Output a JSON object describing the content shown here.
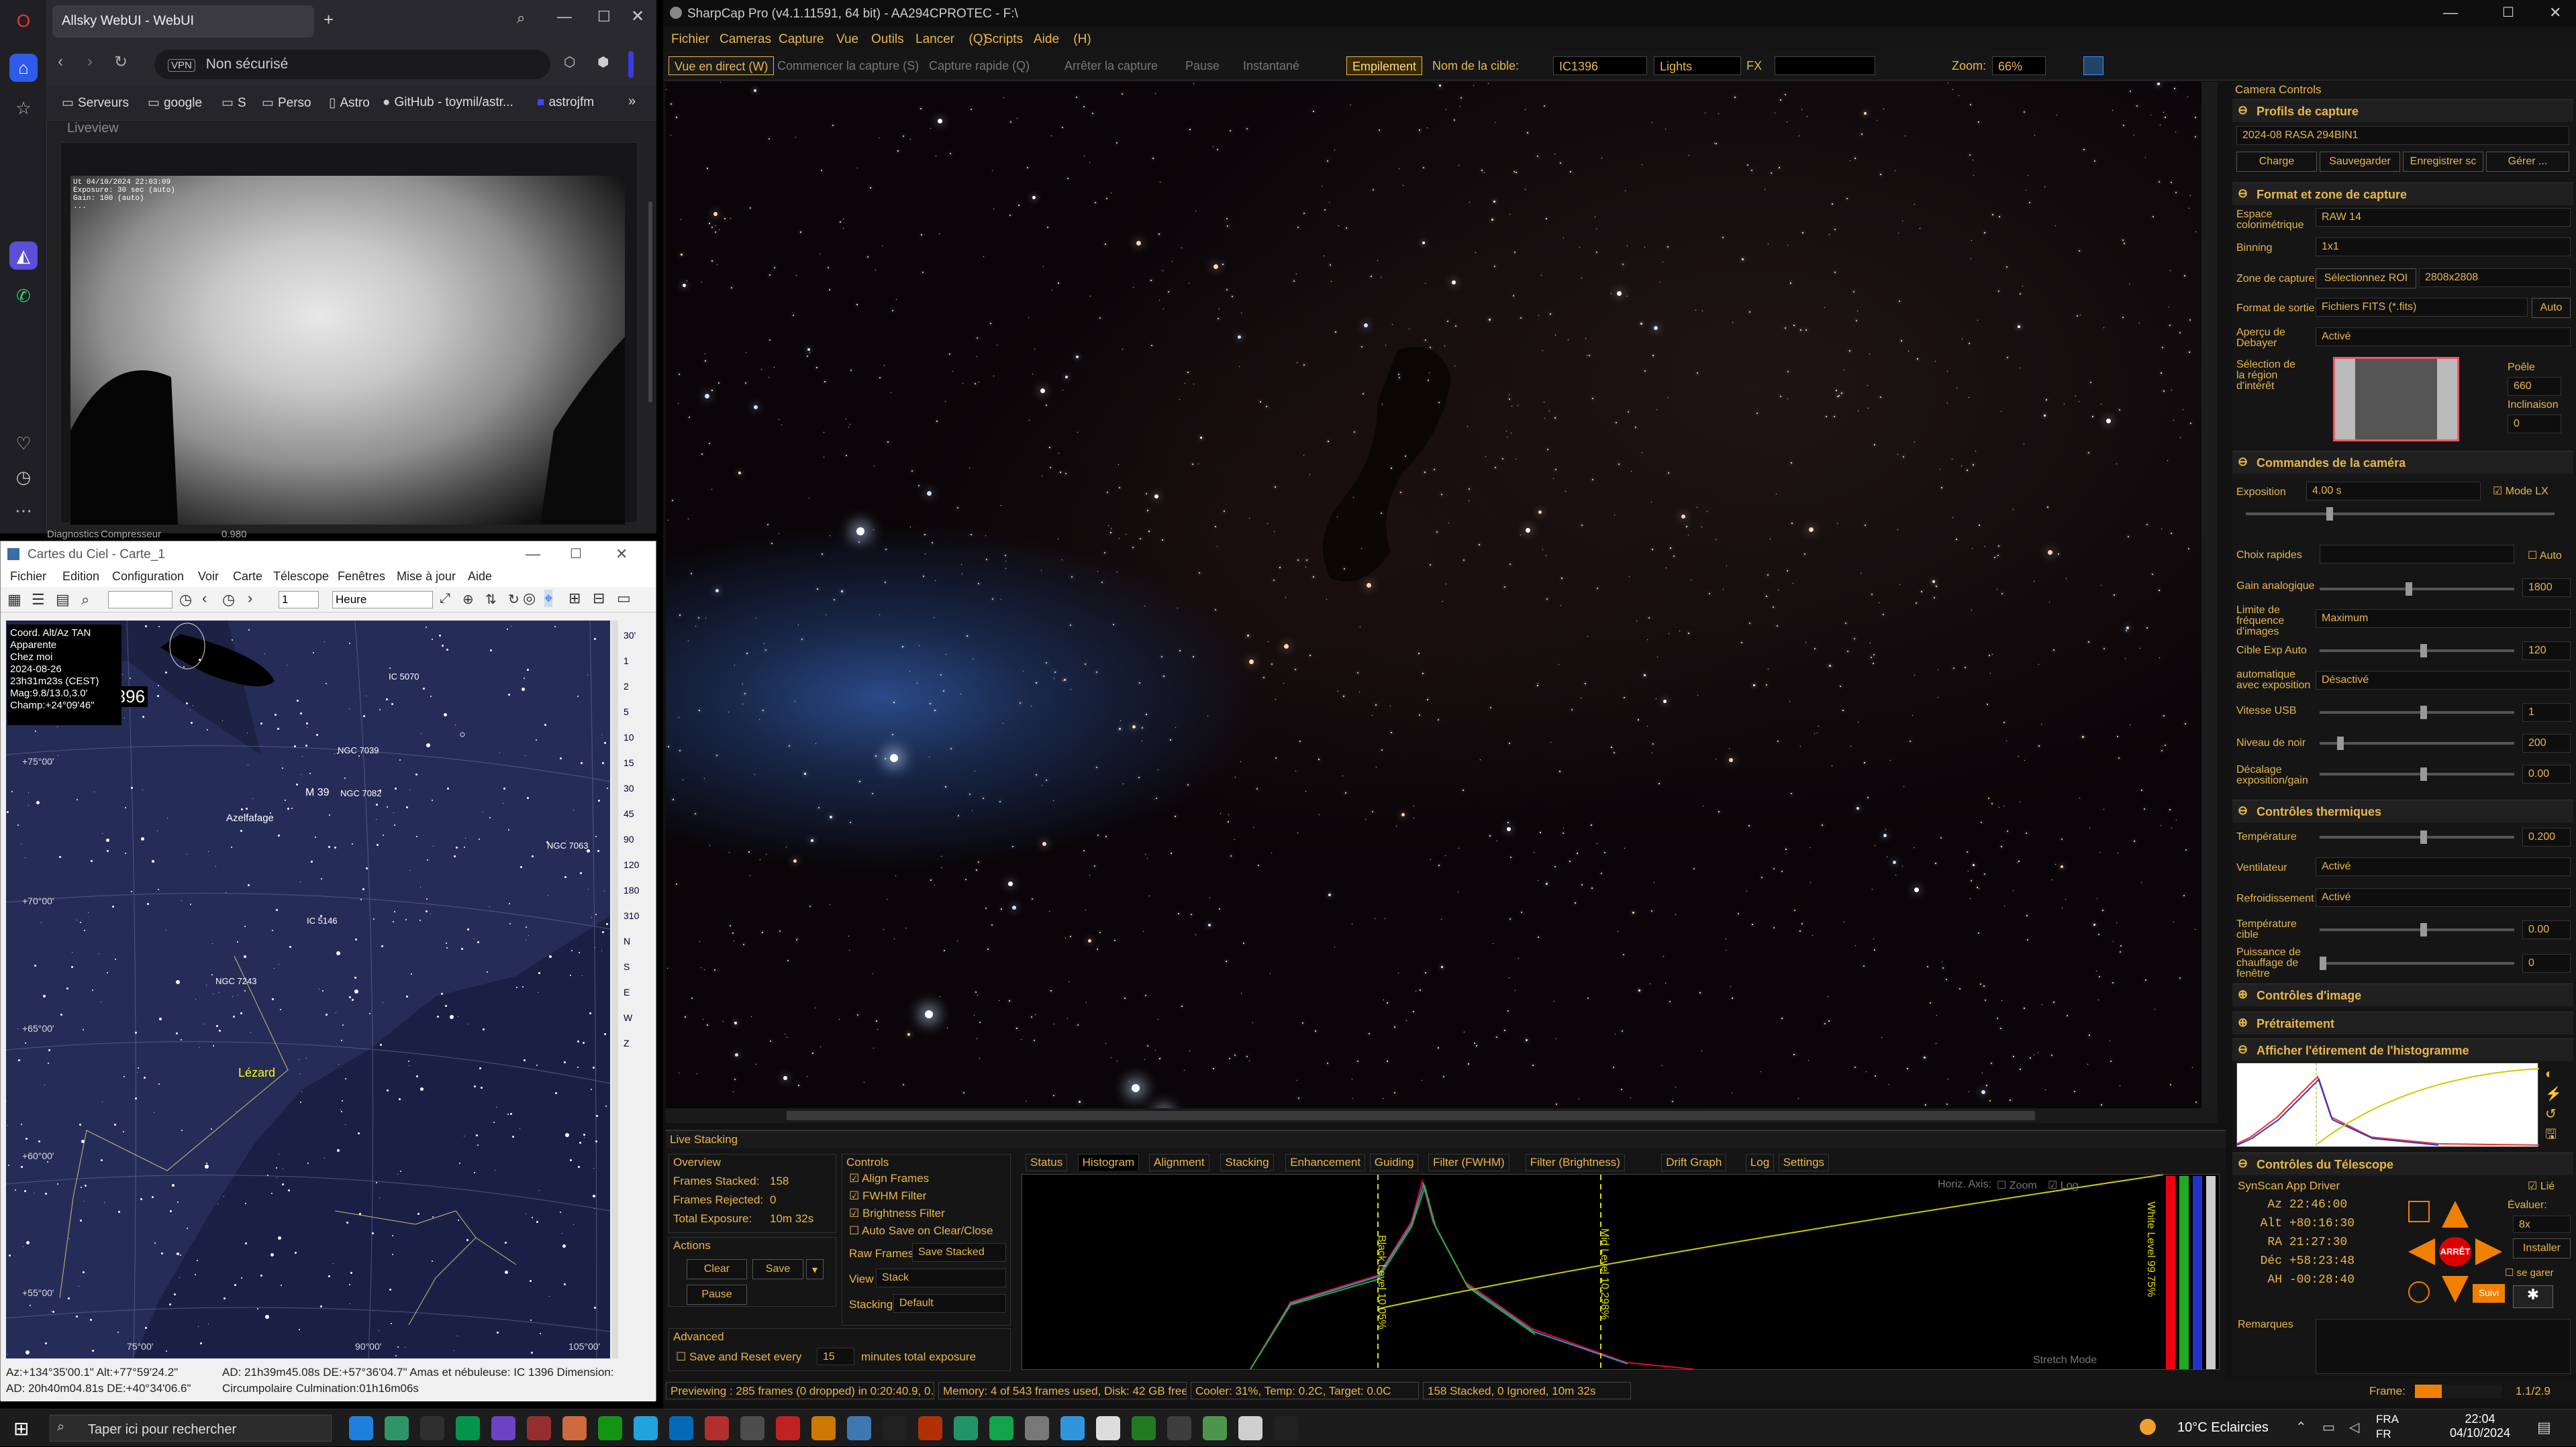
{
  "opera": {
    "tab_title": "Allsky WebUI - WebUI",
    "tab_count": "1",
    "vpn": "VPN",
    "address": "Non sécurisé",
    "bookmarks": [
      "Serveurs",
      "google",
      "S",
      "Perso",
      "Astro",
      "GitHub - toymil/astr...",
      "astrojfm"
    ],
    "liveview_label": "Liveview",
    "overlay_lines": [
      "Ut 04/10/2024 22:03:09",
      "Exposure: 30 sec (auto)",
      "Gain: 100 (auto)",
      "..."
    ],
    "below_labels": [
      "Diagnostics",
      "Compresseur",
      "0.980"
    ]
  },
  "cdc": {
    "title": "Cartes du Ciel - Carte_1",
    "menu": [
      "Fichier",
      "Edition",
      "Configuration",
      "Voir",
      "Carte",
      "Télescope",
      "Fenêtres",
      "Mise à jour",
      "Aide"
    ],
    "time_field": "1",
    "time_unit": "Heure",
    "info_lines": [
      "Coord. Alt/Az TAN",
      "Apparente",
      "Chez moi",
      "2024-08-26",
      "23h31m23s (CEST)",
      "Mag:9.8/13.0,3.0'",
      "Champ:+24°09'46\""
    ],
    "labels": {
      "ic1396": "IC 1396",
      "m39": "M 39",
      "ngc7082": "NGC 7082",
      "ngc7039": "NGC 7039",
      "ngc7063": "NGC 7063",
      "ngc7243": "NGC 7243",
      "ic5146": "IC 5146",
      "ic5070": "IC 5070",
      "azelfafage": "Azelfafage",
      "lezard": "Lézard",
      "alt75": "+75°00'",
      "alt70": "+70°00'",
      "alt65": "+65°00'",
      "alt60": "+60°00'",
      "alt55": "+55°00'",
      "az75": "75°00'",
      "az90": "90°00'",
      "az105": "105°00'"
    },
    "rtools": [
      "30'",
      "1",
      "2",
      "5",
      "10",
      "15",
      "30",
      "45",
      "90",
      "120",
      "180",
      "310",
      "N",
      "S",
      "E",
      "W",
      "Z"
    ],
    "status_line1": "Az:+134°35'00.1\" Alt:+77°59'24.2\"",
    "status_line2": "AD: 20h40m04.81s DE:+40°34'06.6\"",
    "status_right1": "AD: 21h39m45.08s DE:+57°36'04.7\"   Amas et nébuleuse: IC 1396   Dimension:",
    "status_right2": "Circumpolaire   Culmination:01h16m06s"
  },
  "sc": {
    "title": "SharpCap Pro (v4.1.11591, 64 bit) - AA294CPROTEC - F:\\",
    "menu": [
      "Fichier",
      "Cameras",
      "Capture",
      "Vue",
      "Outils",
      "Lancer (Q)",
      "Scripts",
      "Aide (H)"
    ],
    "toolbar": {
      "live": "Vue en direct (W)",
      "start": "Commencer la capture (S)",
      "quick": "Capture rapide (Q)",
      "stop": "Arrêter la capture",
      "pause": "Pause",
      "snap": "Instantané",
      "stack": "Empilement",
      "target_label": "Nom de la cible:",
      "target": "IC1396",
      "frametype": "Lights",
      "fx": "FX",
      "zoom_label": "Zoom:",
      "zoom": "66%"
    },
    "panel": {
      "header": "Camera Controls",
      "profiles_title": "Profils de capture",
      "profile": "2024-08 RASA 294BIN1",
      "profile_buttons": [
        "Charge",
        "Sauvegarder",
        "Enregistrer sc",
        "Gérer ..."
      ],
      "format_title": "Format et zone de capture",
      "color_space_label": "Espace colorimétrique",
      "color_space": "RAW 14",
      "binning_label": "Binning",
      "binning": "1x1",
      "zone_label": "Zone de capture",
      "roi_button": "Sélectionnez ROI",
      "zone": "2808x2808",
      "output_label": "Format de sortie",
      "output": "Fichiers FITS (*.fits)",
      "auto": "Auto",
      "debayer_label": "Aperçu de Debayer",
      "debayer": "Activé",
      "roi_label": "Sélection de la région d'intérêt",
      "poele_label": "Poêle",
      "poele": "660",
      "incl_label": "Inclinaison",
      "incl": "0",
      "cam_title": "Commandes de la caméra",
      "exposure_label": "Exposition",
      "exposure": "4.00 s",
      "mode_lx": "Mode LX",
      "quick_label": "Choix rapides",
      "auto2": "Auto",
      "gain_label": "Gain analogique",
      "gain": "1800",
      "fps_label": "Limite de fréquence d'images",
      "fps": "Maximum",
      "autoexp_label": "Cible Exp Auto",
      "autoexp": "120",
      "autoexp2_label": "automatique avec exposition",
      "autoexp2": "Désactivé",
      "usb_label": "Vitesse USB",
      "usb": "1",
      "black_label": "Niveau de noir",
      "black": "200",
      "offset_label": "Décalage exposition/gain",
      "offset": "0.00",
      "thermal_title": "Contrôles thermiques",
      "temp_label": "Température",
      "temp": "0.200",
      "fan_label": "Ventilateur",
      "fan": "Activé",
      "cool_label": "Refroidissement",
      "cool": "Activé",
      "target_temp_label": "Température cible",
      "target_temp": "0.00",
      "heater_label": "Puissance de chauffage de fenêtre",
      "heater": "0",
      "image_title": "Contrôles d'image",
      "preproc_title": "Prétraitement",
      "hist_title": "Afficher l'étirement de l'histogramme",
      "tel_title": "Contrôles du Télescope",
      "driver": "SynScan App Driver",
      "lie": "Lié",
      "az_label": "Az",
      "az": "22:46:00",
      "alt_label": "Alt",
      "alt": "+80:16:30",
      "ra_label": "RA",
      "ra": "21:27:30",
      "dec_label": "Déc",
      "dec": "+58:23:48",
      "ah_label": "AH",
      "ah": "-00:28:40",
      "rate_label": "Évaluer:",
      "rate": "8x",
      "install": "Installer",
      "garer": "se garer",
      "stop": "ARRÊT",
      "suivi": "Suivi",
      "remarks": "Remarques"
    },
    "ls": {
      "title": "Live Stacking",
      "overview": "Overview",
      "stacked_label": "Frames Stacked:",
      "stacked": "158",
      "rejected_label": "Frames Rejected:",
      "rejected": "0",
      "total_label": "Total Exposure:",
      "total": "10m 32s",
      "actions": "Actions",
      "clear": "Clear",
      "save": "Save",
      "pause": "Pause",
      "advanced": "Advanced",
      "save_reset": "Save and Reset every",
      "every_val": "15",
      "every_unit": "minutes total exposure",
      "controls": "Controls",
      "align": "Align Frames",
      "fwhm": "FWHM Filter",
      "bright": "Brightness Filter",
      "autosave": "Auto Save on Clear/Close",
      "raw_label": "Raw Frames",
      "raw": "Save Stacked",
      "view_label": "View",
      "view": "Stack",
      "stacking_label": "Stacking",
      "stacking": "Default",
      "tabs": [
        "Status",
        "Histogram",
        "Alignment",
        "Stacking",
        "Enhancement",
        "Guiding",
        "Filter (FWHM)",
        "Filter (Brightness)",
        "Drift Graph",
        "Log",
        "Settings"
      ],
      "horiz": "Horiz. Axis:",
      "zoom": "Zoom",
      "log": "Log",
      "black_level": "Black Level 10.05%",
      "mid_level": "Mid Level 10.298%",
      "white_level": "White Level 99.75%",
      "stretch": "Stretch Mode"
    },
    "status": {
      "preview": "Previewing : 285 frames (0 dropped) in 0:20:40.9, 0.2 fps",
      "memory": "Memory: 4 of 543 frames used, Disk: 42 GB free",
      "cooler": "Cooler: 31%, Temp: 0.2C, Target: 0.0C",
      "stack": "158 Stacked, 0 Ignored, 10m 32s",
      "frame_label": "Frame:",
      "frame": "1.1/2.9"
    }
  },
  "taskbar": {
    "search": "Taper ici pour rechercher",
    "weather": "10°C  Eclaircies",
    "lang": "FRA\nFR",
    "time": "22:04",
    "date": "04/10/2024"
  },
  "colors": {
    "accent": "#e8b74a",
    "highlight": "#ff6a00",
    "sc_bg": "#151515"
  }
}
